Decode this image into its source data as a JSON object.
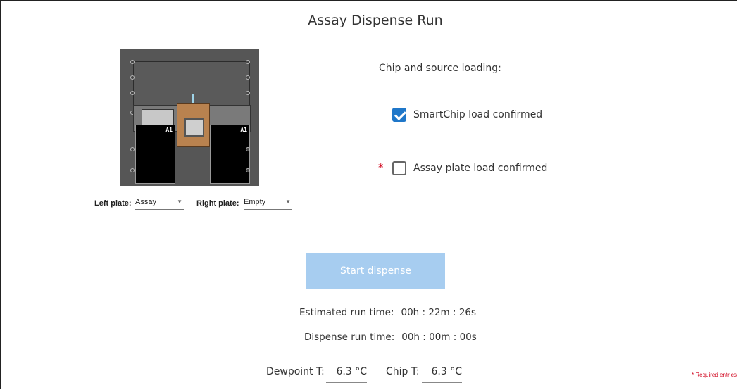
{
  "title": "Assay Dispense Run",
  "illustration": {
    "left_plate_marker": "A1",
    "right_plate_marker": "A1"
  },
  "plate_selection": {
    "left_label": "Left plate:",
    "left_value": "Assay",
    "right_label": "Right plate:",
    "right_value": "Empty"
  },
  "loading": {
    "section_label": "Chip and source loading:",
    "smartchip_label": "SmartChip load confirmed",
    "smartchip_checked": true,
    "assay_plate_label": "Assay plate load confirmed",
    "assay_plate_checked": false,
    "required_marker": "*"
  },
  "start_button_label": "Start dispense",
  "run_info": {
    "estimated_label": "Estimated run time:",
    "estimated_value": "00h : 22m : 26s",
    "dispense_label": "Dispense run time:",
    "dispense_value": "00h : 00m : 00s"
  },
  "temperatures": {
    "dewpoint_label": "Dewpoint T:",
    "dewpoint_value": "6.3 °C",
    "chip_label": "Chip T:",
    "chip_value": "6.3 °C"
  },
  "required_note": "* Required entries",
  "colors": {
    "accent": "#1f77c9",
    "disabled_button": "#a7cdf0",
    "required": "#d0021b"
  }
}
